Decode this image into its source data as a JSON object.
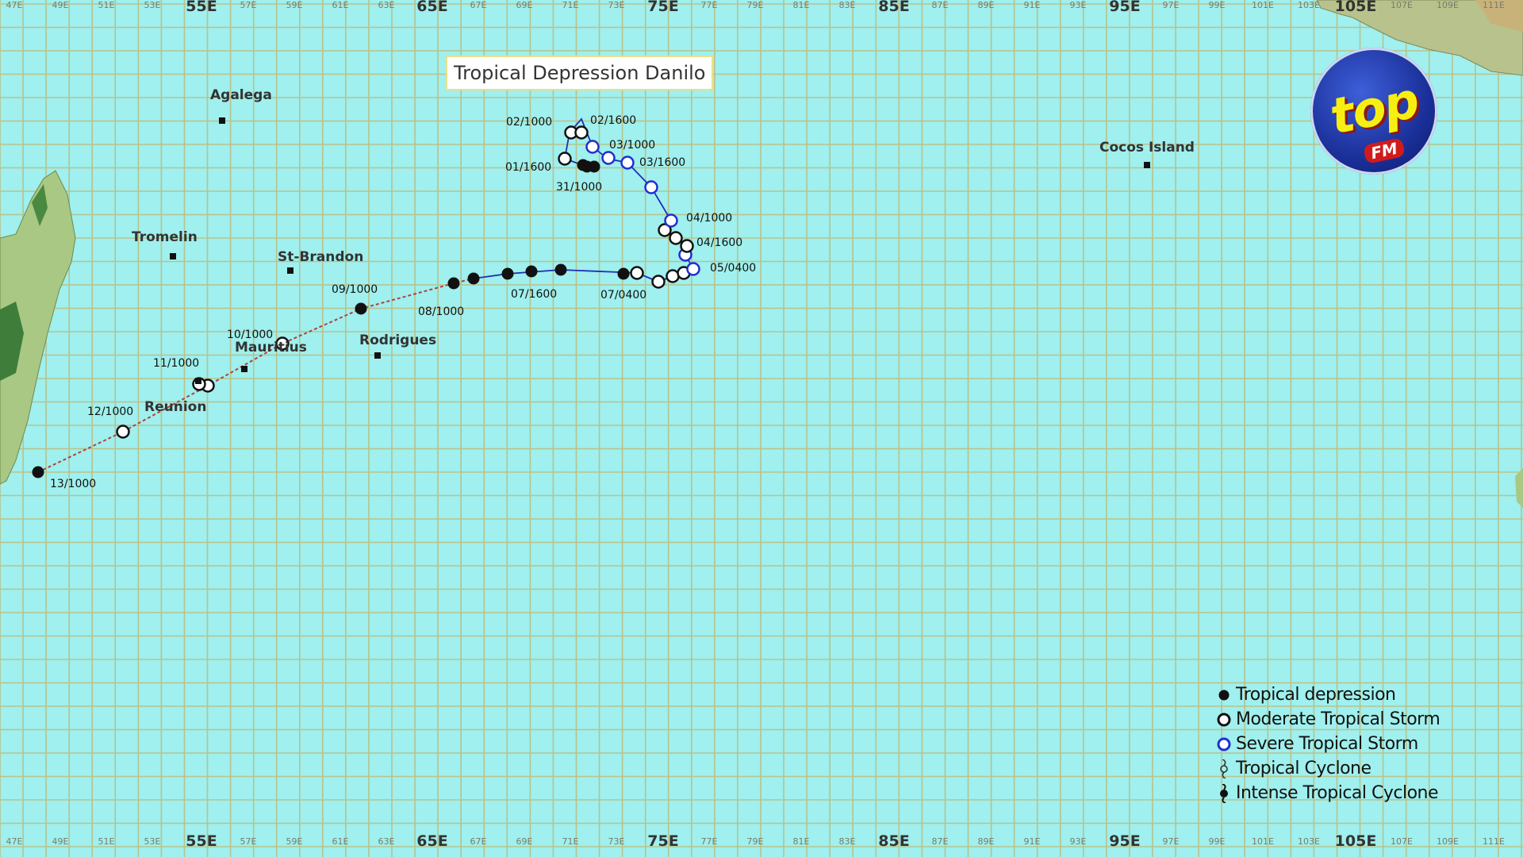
{
  "title": "Tropical Depression Danilo",
  "colors": {
    "ocean": "#9ff0ee",
    "grid": "#b7c28d",
    "track_dashed": "#b0413e",
    "track_solid": "#1f2fb8",
    "severe_storm": "#1f2fd0",
    "land": "#a8c884"
  },
  "longitude_labels_major": [
    "55E",
    "65E",
    "75E",
    "85E",
    "95E",
    "105E"
  ],
  "longitude_labels_minor": [
    "47E",
    "49E",
    "51E",
    "53E",
    "57E",
    "59E",
    "61E",
    "63E",
    "67E",
    "69E",
    "71E",
    "73E",
    "77E",
    "79E",
    "81E",
    "83E",
    "87E",
    "89E",
    "91E",
    "93E",
    "97E",
    "99E",
    "101E",
    "103E",
    "107E",
    "109E",
    "111E"
  ],
  "places": [
    {
      "id": "agalega",
      "name": "Agalega"
    },
    {
      "id": "tromelin",
      "name": "Tromelin"
    },
    {
      "id": "st-brandon",
      "name": "St-Brandon"
    },
    {
      "id": "mauritius",
      "name": "Mauritius"
    },
    {
      "id": "rodrigues",
      "name": "Rodrigues"
    },
    {
      "id": "reunion",
      "name": "Reunion"
    },
    {
      "id": "cocos-island",
      "name": "Cocos Island"
    }
  ],
  "track_labels": [
    "02/1000",
    "02/1600",
    "03/1000",
    "03/1600",
    "01/1600",
    "31/1000",
    "04/1000",
    "04/1600",
    "05/0400",
    "07/0400",
    "07/1600",
    "08/1000",
    "09/1000",
    "10/1000",
    "11/1000",
    "12/1000",
    "13/1000"
  ],
  "legend": [
    {
      "symbol": "tropical-depression",
      "label": "Tropical depression"
    },
    {
      "symbol": "moderate-tropical-storm",
      "label": "Moderate Tropical Storm"
    },
    {
      "symbol": "severe-tropical-storm",
      "label": "Severe Tropical Storm"
    },
    {
      "symbol": "tropical-cyclone",
      "label": "Tropical Cyclone"
    },
    {
      "symbol": "intense-tropical-cyclone",
      "label": "Intense Tropical Cyclone"
    }
  ],
  "logo": {
    "main": "top",
    "sub": "FM"
  }
}
